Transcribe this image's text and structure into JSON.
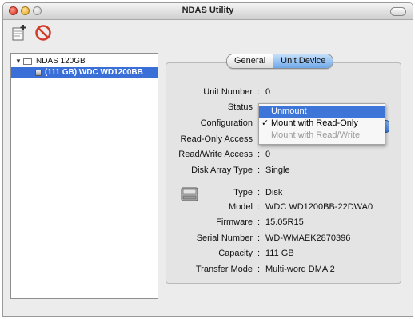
{
  "window": {
    "title": "NDAS Utility"
  },
  "toolbar": {
    "add_icon": "add-device-icon",
    "remove_icon": "no-entry-icon"
  },
  "tree": {
    "root": {
      "label": "NDAS 120GB",
      "expanded": true
    },
    "child": {
      "label": "(111 GB) WDC WD1200BB",
      "selected": true
    }
  },
  "tabs": [
    {
      "label": "General",
      "active": false
    },
    {
      "label": "Unit Device",
      "active": true
    }
  ],
  "fields": {
    "unit_number": {
      "label": "Unit Number",
      "value": "0"
    },
    "status": {
      "label": "Status"
    },
    "configuration": {
      "label": "Configuration"
    },
    "ro_access": {
      "label": "Read-Only Access"
    },
    "rw_access": {
      "label": "Read/Write Access",
      "value": "0"
    },
    "array_type": {
      "label": "Disk Array Type",
      "value": "Single"
    },
    "type": {
      "label": "Type",
      "value": "Disk"
    },
    "model": {
      "label": "Model",
      "value": "WDC WD1200BB-22DWA0"
    },
    "firmware": {
      "label": "Firmware",
      "value": "15.05R15"
    },
    "serial": {
      "label": "Serial Number",
      "value": "WD-WMAEK2870396"
    },
    "capacity": {
      "label": "Capacity",
      "value": "111 GB"
    },
    "transfer": {
      "label": "Transfer Mode",
      "value": "Multi-word DMA 2"
    }
  },
  "config_menu": {
    "items": [
      {
        "label": "Unmount",
        "checked": false,
        "highlighted": true,
        "enabled": true
      },
      {
        "label": "Mount with Read-Only",
        "checked": true,
        "highlighted": false,
        "enabled": true
      },
      {
        "label": "Mount with Read/Write",
        "checked": false,
        "highlighted": false,
        "enabled": false
      }
    ],
    "checkmark": "✓"
  },
  "colors": {
    "selection": "#3a6fd8",
    "menu_highlight": "#3d76d8",
    "tab_active": "#6fa7e9"
  }
}
